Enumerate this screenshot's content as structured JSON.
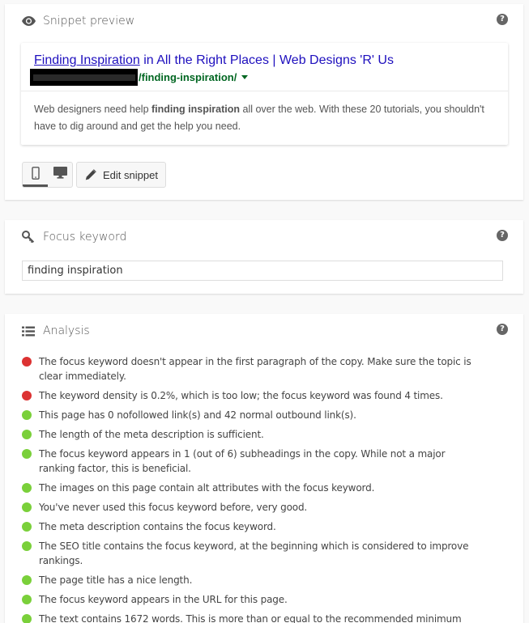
{
  "colors": {
    "bad": "#dc3232",
    "good": "#7ad03a",
    "link": "#1e0fbe",
    "url": "#006621"
  },
  "snippet_panel": {
    "title": "Snippet preview",
    "help_icon": "?",
    "preview": {
      "title_keyword": "Finding Inspiration",
      "title_rest": " in All the Right Places | Web Designs 'R' Us",
      "url_path": "/finding-inspiration/",
      "description_before": "Web designers need help ",
      "description_keyword": "finding inspiration",
      "description_after": " all over the web. With these 20 tutorials, you shouldn't have to dig around and get the help you need."
    },
    "device_toggle": {
      "mobile_icon": "mobile-icon",
      "desktop_icon": "desktop-icon",
      "active": "mobile"
    },
    "edit_button_label": "Edit snippet"
  },
  "focus_panel": {
    "title": "Focus keyword",
    "help_icon": "?",
    "input_value": "finding inspiration"
  },
  "analysis_panel": {
    "title": "Analysis",
    "help_icon": "?",
    "items": [
      {
        "status": "bad",
        "text": "The focus keyword doesn't appear in the first paragraph of the copy. Make sure the topic is clear immediately."
      },
      {
        "status": "bad",
        "text": "The keyword density is 0.2%, which is too low; the focus keyword was found 4 times."
      },
      {
        "status": "good",
        "text": "This page has 0 nofollowed link(s) and 42 normal outbound link(s)."
      },
      {
        "status": "good",
        "text": "The length of the meta description is sufficient."
      },
      {
        "status": "good",
        "text": "The focus keyword appears in 1 (out of 6) subheadings in the copy. While not a major ranking factor, this is beneficial."
      },
      {
        "status": "good",
        "text": "The images on this page contain alt attributes with the focus keyword."
      },
      {
        "status": "good",
        "text": "You've never used this focus keyword before, very good."
      },
      {
        "status": "good",
        "text": "The meta description contains the focus keyword."
      },
      {
        "status": "good",
        "text": "The SEO title contains the focus keyword, at the beginning which is considered to improve rankings."
      },
      {
        "status": "good",
        "text": "The page title has a nice length."
      },
      {
        "status": "good",
        "text": "The focus keyword appears in the URL for this page."
      },
      {
        "status": "good",
        "text": "The text contains 1672 words. This is more than or equal to the recommended minimum"
      }
    ]
  }
}
